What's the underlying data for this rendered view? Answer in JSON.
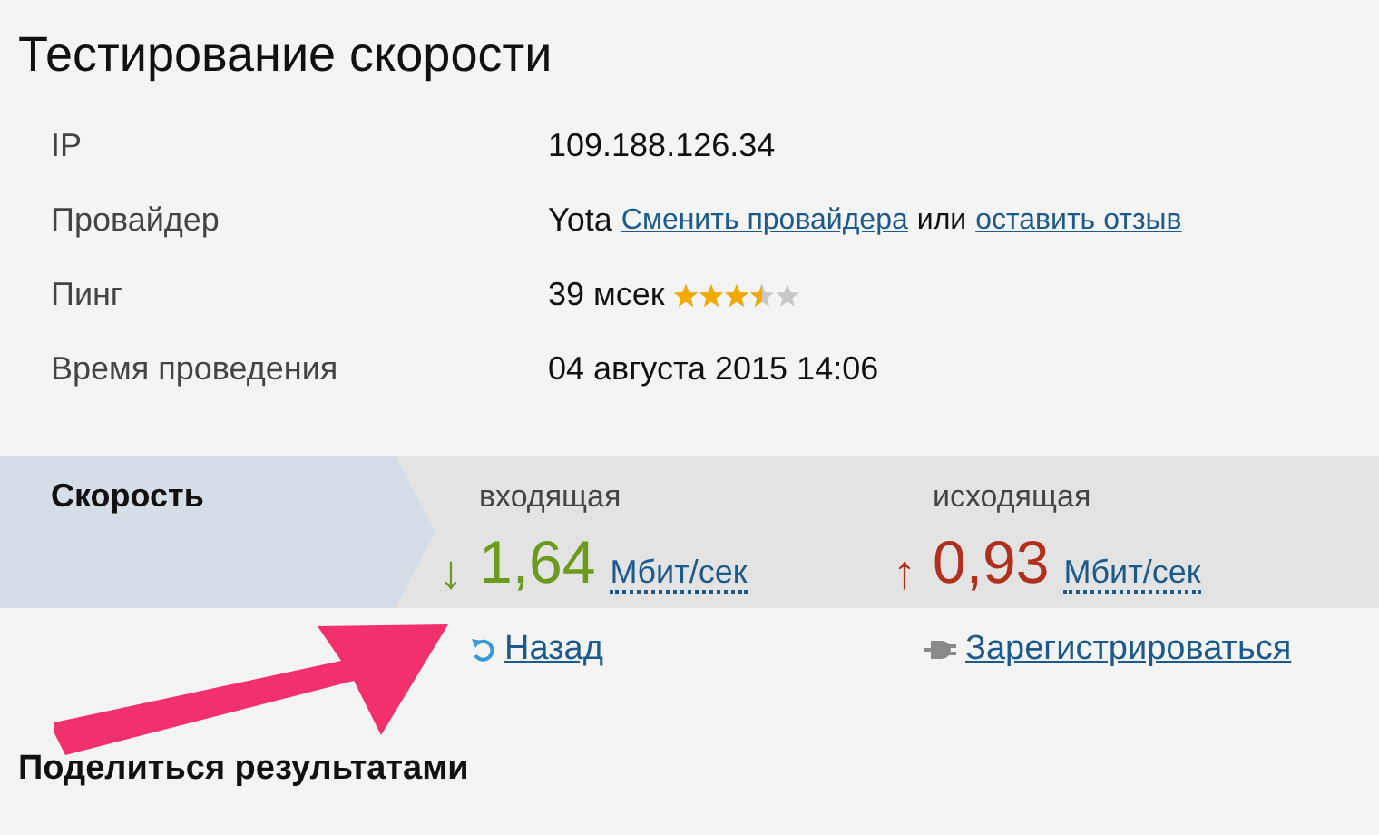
{
  "title": "Тестирование скорости",
  "info": [
    {
      "label": "IP",
      "kind": "text",
      "value": "109.188.126.34"
    },
    {
      "label": "Провайдер",
      "kind": "provider",
      "value": "Yota",
      "link1": "Сменить провайдера",
      "middle": "или",
      "link2": "оставить отзыв"
    },
    {
      "label": "Пинг",
      "kind": "rating",
      "value": "39 мсек",
      "stars": 3.5
    },
    {
      "label": "Время проведения",
      "kind": "text",
      "value": "04 августа 2015 14:06"
    }
  ],
  "speed": {
    "label": "Скорость",
    "directions": [
      {
        "kind": "down",
        "caption": "входящая",
        "arrow": "↓",
        "value": "1,64",
        "unit": "Мбит/сек",
        "color": "#6b9a1c"
      },
      {
        "kind": "up",
        "caption": "исходящая",
        "arrow": "↑",
        "value": "0,93",
        "unit": "Мбит/сек",
        "color": "#b0301e"
      }
    ]
  },
  "actions": [
    {
      "kind": "back",
      "label": "Назад"
    },
    {
      "kind": "register",
      "label": "Зарегистрироваться"
    }
  ],
  "share_heading": "Поделиться результатами"
}
